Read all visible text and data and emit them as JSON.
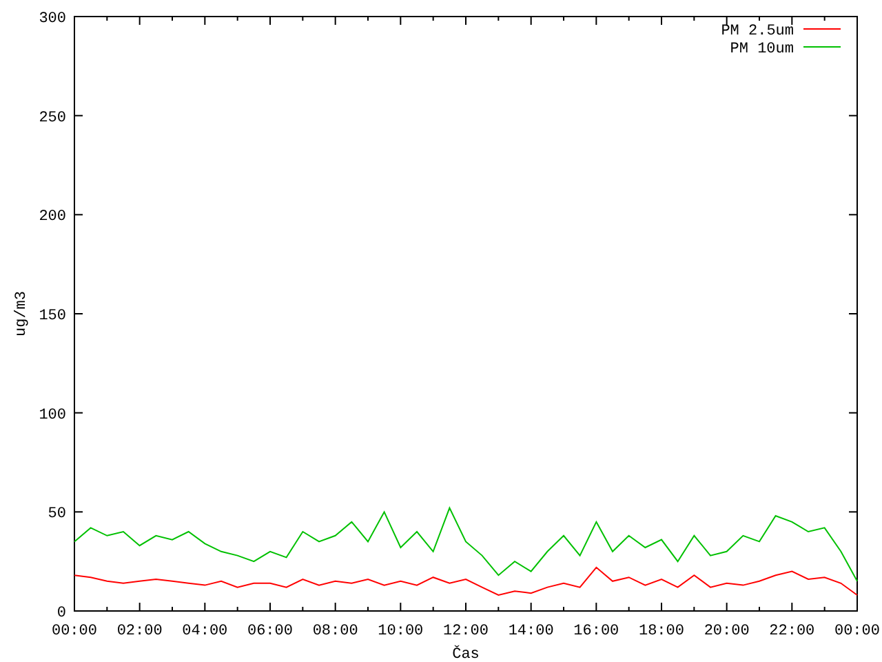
{
  "chart_data": {
    "type": "line",
    "xlabel": "Čas",
    "ylabel": "ug/m3",
    "legend": true,
    "x": [
      0,
      0.5,
      1,
      1.5,
      2,
      2.5,
      3,
      3.5,
      4,
      4.5,
      5,
      5.5,
      6,
      6.5,
      7,
      7.5,
      8,
      8.5,
      9,
      9.5,
      10,
      10.5,
      11,
      11.5,
      12,
      12.5,
      13,
      13.5,
      14,
      14.5,
      15,
      15.5,
      16,
      16.5,
      17,
      17.5,
      18,
      18.5,
      19,
      19.5,
      20,
      20.5,
      21,
      21.5,
      22,
      22.5,
      23,
      23.5,
      24
    ],
    "series": [
      {
        "name": "PM 2.5um",
        "color": "#ff0000",
        "values": [
          18,
          17,
          15,
          14,
          15,
          16,
          15,
          14,
          13,
          15,
          12,
          14,
          14,
          12,
          16,
          13,
          15,
          14,
          16,
          13,
          15,
          13,
          17,
          14,
          16,
          12,
          8,
          10,
          9,
          12,
          14,
          12,
          22,
          15,
          17,
          13,
          16,
          12,
          18,
          12,
          14,
          13,
          15,
          18,
          20,
          16,
          17,
          14,
          8
        ]
      },
      {
        "name": "PM 10um",
        "color": "#00c000",
        "values": [
          35,
          42,
          38,
          40,
          33,
          38,
          36,
          40,
          34,
          30,
          28,
          25,
          30,
          27,
          40,
          35,
          38,
          45,
          35,
          50,
          32,
          40,
          30,
          52,
          35,
          28,
          18,
          25,
          20,
          30,
          38,
          28,
          45,
          30,
          38,
          32,
          36,
          25,
          38,
          28,
          30,
          38,
          35,
          48,
          45,
          40,
          42,
          30,
          15
        ]
      }
    ],
    "xlim": [
      0,
      24
    ],
    "ylim": [
      0,
      300
    ],
    "xticks": [
      {
        "value": 0,
        "label": "00:00"
      },
      {
        "value": 2,
        "label": "02:00"
      },
      {
        "value": 4,
        "label": "04:00"
      },
      {
        "value": 6,
        "label": "06:00"
      },
      {
        "value": 8,
        "label": "08:00"
      },
      {
        "value": 10,
        "label": "10:00"
      },
      {
        "value": 12,
        "label": "12:00"
      },
      {
        "value": 14,
        "label": "14:00"
      },
      {
        "value": 16,
        "label": "16:00"
      },
      {
        "value": 18,
        "label": "18:00"
      },
      {
        "value": 20,
        "label": "20:00"
      },
      {
        "value": 22,
        "label": "22:00"
      },
      {
        "value": 24,
        "label": "00:00"
      }
    ],
    "yticks": [
      0,
      50,
      100,
      150,
      200,
      250,
      300
    ]
  }
}
